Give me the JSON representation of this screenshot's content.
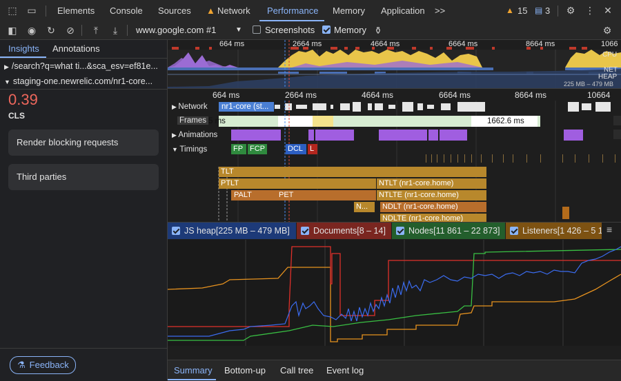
{
  "topbar": {
    "tabs": [
      "Elements",
      "Console",
      "Sources",
      "Network",
      "Performance",
      "Memory",
      "Application"
    ],
    "more": ">>",
    "warnings": "15",
    "messages": "3"
  },
  "toolbar": {
    "recording": "www.google.com #1",
    "screenshots": "Screenshots",
    "memory": "Memory"
  },
  "sidebar": {
    "tabs": [
      "Insights",
      "Annotations"
    ],
    "rows": [
      "/search?q=what ti...&sca_esv=ef81e...",
      "staging-one.newrelic.com/nr1-core..."
    ],
    "cls_value": "0.39",
    "cls_label": "CLS",
    "cards": [
      "Render blocking requests",
      "Third parties"
    ],
    "feedback": "Feedback"
  },
  "overview": {
    "ticks": [
      "664 ms",
      "2664 ms",
      "4664 ms",
      "6664 ms",
      "8664 ms",
      "1066"
    ],
    "cpu": "CPU",
    "net": "NET",
    "heap": "HEAP",
    "heap_range": "225 MB – 479 MB"
  },
  "timeline": {
    "ticks": [
      "664 ms",
      "2664 ms",
      "4664 ms",
      "6664 ms",
      "8664 ms",
      "10664"
    ],
    "tracks": [
      "Network",
      "Frames",
      "Animations",
      "Timings"
    ],
    "network_label": "nr1-core (st...",
    "frames_left": "5 ms",
    "frames_right": "1662.6 ms",
    "markers": [
      "FP",
      "FCP",
      "DCL",
      "L"
    ],
    "timing_bars": [
      "TLT",
      "PTLT",
      "NTLT (nr1-core.home)",
      "PALT",
      "PET",
      "NTLTE (nr1-core.home)",
      "N...",
      "NDLT (nr1-core.home)",
      "NDLTE (nr1-core.home)"
    ]
  },
  "legend": [
    {
      "label": "JS heap[225 MB – 479 MB]",
      "color": "#2b56b8"
    },
    {
      "label": "Documents[8 – 14]",
      "color": "#9c2d25"
    },
    {
      "label": "Nodes[11 861 – 22 873]",
      "color": "#2a7a36"
    },
    {
      "label": "Listeners[1 426 – 5 1",
      "color": "#a5670c"
    }
  ],
  "bottom_tabs": [
    "Summary",
    "Bottom-up",
    "Call tree",
    "Event log"
  ],
  "colors": {
    "accent": "#8ab4f8",
    "jsheap": "#3b6cf0",
    "documents": "#e0302a",
    "nodes": "#39c043",
    "listeners": "#e8931f"
  }
}
